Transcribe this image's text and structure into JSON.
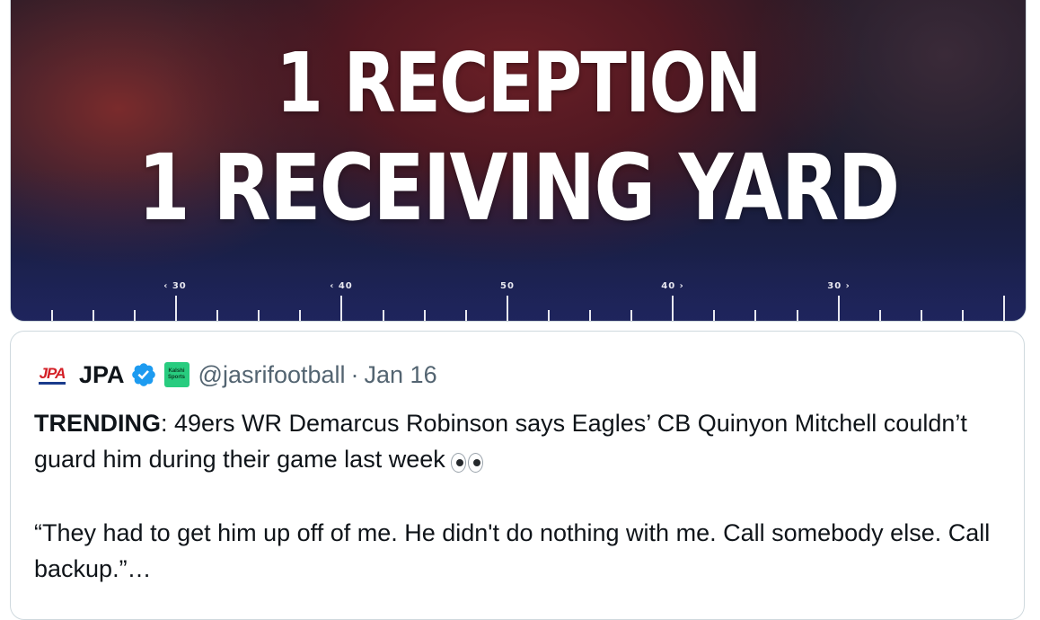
{
  "media": {
    "line1": "1 RECEPTION",
    "line2": "1 RECEIVING YARD",
    "yard_markers": [
      "‹ 30",
      "‹ 40",
      "50",
      "40 ›",
      "30 ›"
    ]
  },
  "quote": {
    "author_name": "JPA",
    "logo_text": "JPA",
    "badge_text_1": "Kalshi",
    "badge_text_2": "Sports",
    "handle": "@jasrifootball",
    "separator": "·",
    "date": "Jan 16",
    "label": "TRENDING",
    "line1_rest": ": 49ers WR Demarcus Robinson says Eagles’ CB Quinyon Mitchell couldn’t guard him during their game last week",
    "line2": "“They had to get him up off of me. He didn't do nothing with me. Call somebody else. Call backup.”…",
    "emoji": "eyes"
  },
  "colors": {
    "verified": "#1d9bf0",
    "kalshi": "#28cc7f",
    "muted_text": "#536471",
    "border": "#cfd9de"
  }
}
